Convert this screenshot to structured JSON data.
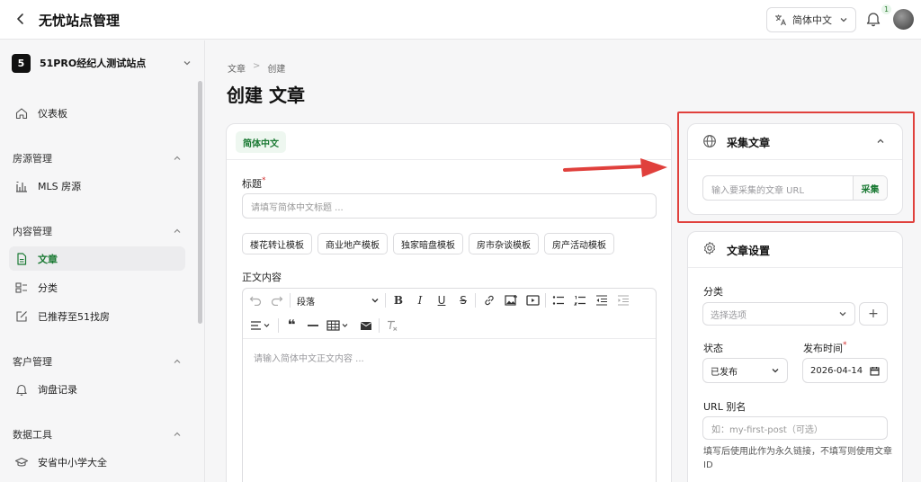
{
  "app": {
    "title": "无忧站点管理"
  },
  "header": {
    "language": "简体中文",
    "notification_count": "1"
  },
  "sidebar": {
    "site_badge": "5",
    "site_name": "51PRO经纪人测试站点",
    "dashboard": "仪表板",
    "groups": {
      "property": "房源管理",
      "content": "内容管理",
      "customer": "客户管理",
      "data": "数据工具"
    },
    "items": {
      "mls": "MLS 房源",
      "articles": "文章",
      "categories": "分类",
      "recommended": "已推荐至51找房",
      "inquiries": "询盘记录",
      "schools": "安省中小学大全"
    }
  },
  "breadcrumb": {
    "parent": "文章",
    "separator": ">",
    "current": "创建"
  },
  "page": {
    "title": "创建 文章"
  },
  "editor": {
    "language_tab": "简体中文",
    "title_label": "标题",
    "title_required": "*",
    "title_placeholder": "请填写简体中文标题 ...",
    "templates": [
      "楼花转让模板",
      "商业地产模板",
      "独家暗盘模板",
      "房市杂谈模板",
      "房产活动模板"
    ],
    "body_label": "正文内容",
    "paragraph_select": "段落",
    "body_placeholder": "请输入简体中文正文内容 ..."
  },
  "collect_panel": {
    "title": "采集文章",
    "url_placeholder": "输入要采集的文章 URL",
    "button": "采集"
  },
  "settings_panel": {
    "title": "文章设置",
    "category_label": "分类",
    "category_placeholder": "选择选项",
    "add_symbol": "+",
    "status_label": "状态",
    "status_value": "已发布",
    "publish_time_label": "发布时间",
    "publish_time_required": "*",
    "publish_time_value": "2026-04-14",
    "slug_label": "URL 别名",
    "slug_placeholder": "如：my-first-post（可选）",
    "slug_help": "填写后使用此作为永久链接，不填写则使用文章 ID"
  },
  "colors": {
    "accent": "#1b7a34",
    "highlight": "#e0403c"
  }
}
